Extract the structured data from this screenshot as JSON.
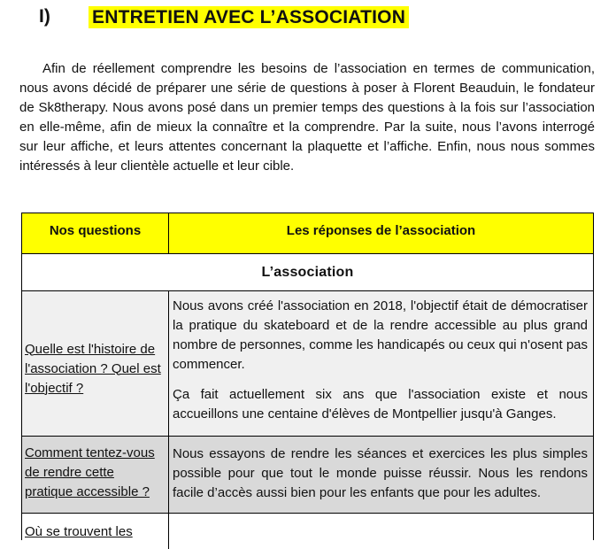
{
  "heading": {
    "number": "I)",
    "title": "ENTRETIEN AVEC L’ASSOCIATION"
  },
  "intro": "Afin de réellement comprendre les besoins de l’association en termes de communication, nous avons décidé de préparer une série de questions à poser à Florent Beauduin, le fondateur de Sk8therapy. Nous avons posé dans un premier temps des questions à la fois sur l’association en elle-même, afin de mieux la connaître et la comprendre. Par la suite, nous l’avons interrogé sur leur affiche, et leurs attentes concernant la plaquette et l’affiche. Enfin, nous nous sommes intéressés à leur clientèle actuelle et leur cible.",
  "table": {
    "header_questions": "Nos questions",
    "header_answers": "Les réponses de l’association",
    "section_title": "L’association",
    "rows": [
      {
        "question": "Quelle est l'histoire de l'association ? Quel est l'objectif ?",
        "answer_p1": "Nous avons créé l'association en 2018, l'objectif était de démocratiser la pratique du skateboard et de la rendre accessible au plus grand nombre de personnes, comme les handicapés ou ceux qui n'osent pas commencer.",
        "answer_p2": "Ça fait actuellement six ans que l'association existe et nous accueillons une centaine d'élèves de Montpellier jusqu'à Ganges."
      },
      {
        "question": "Comment tentez-vous de rendre cette pratique accessible ?",
        "answer_p1": "Nous essayons de rendre les séances et exercices les plus simples possible pour que tout le monde puisse réussir. Nous les rendons facile d’accès aussi bien pour les enfants que pour les adultes."
      },
      {
        "question": "Où se trouvent les"
      }
    ]
  }
}
